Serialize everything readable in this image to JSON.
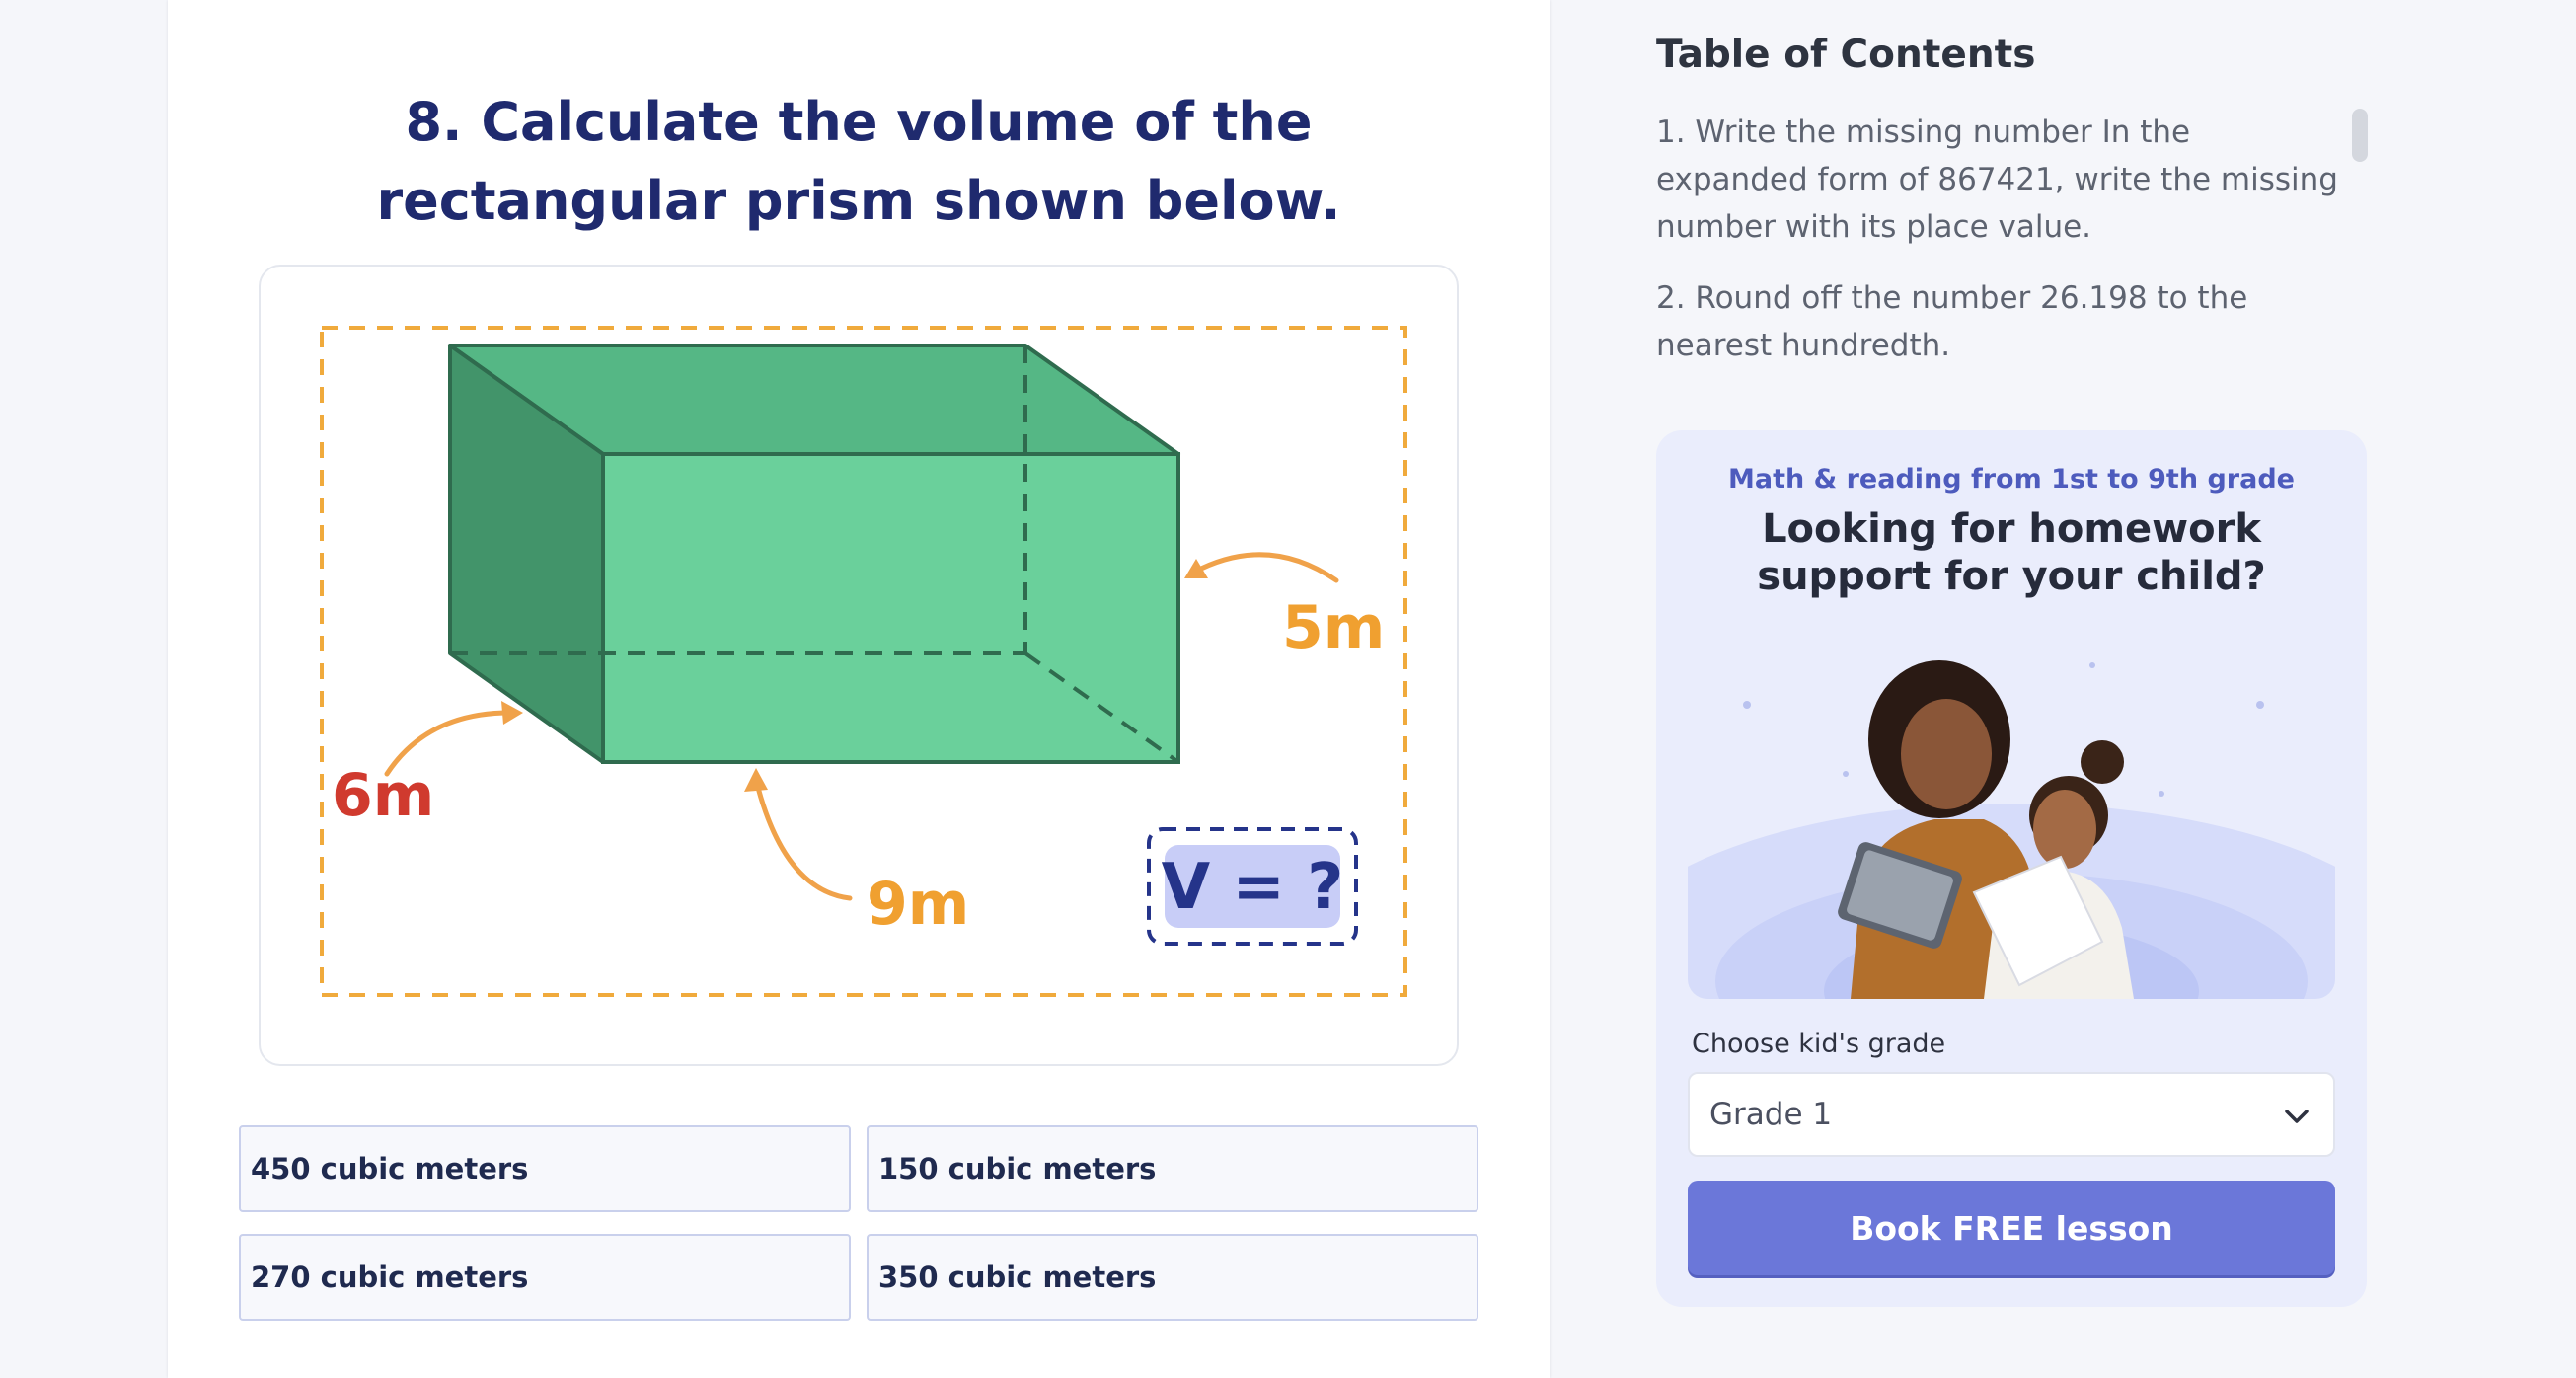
{
  "question": {
    "title": "8. Calculate the volume of the rectangular prism shown below.",
    "figure": {
      "label_depth": "6m",
      "label_length": "9m",
      "label_height": "5m",
      "label_volume": "V = ?",
      "colors": {
        "prism_front": "#6ad09b",
        "prism_top": "#55b785",
        "prism_side": "#42946a",
        "edge": "#2f6b4e",
        "dashed_frame": "#f0aa3c",
        "arrow": "#f0a24a",
        "label_red": "#d03a2e",
        "label_orange": "#f0a030",
        "volume_text": "#25348a",
        "volume_bg": "#c8cdf7"
      }
    },
    "options": [
      {
        "label": "450 cubic meters"
      },
      {
        "label": "150 cubic meters"
      },
      {
        "label": "270 cubic meters"
      },
      {
        "label": "350 cubic meters"
      }
    ]
  },
  "toc": {
    "title": "Table of Contents",
    "items": [
      {
        "label": "1. Write the missing number In the expanded form of 867421, write the missing number with its place value."
      },
      {
        "label": "2. Round off the number 26.198 to the nearest hundredth."
      }
    ]
  },
  "promo": {
    "kicker": "Math & reading from 1st to 9th grade",
    "title": "Looking for homework support for your child?",
    "grade_label": "Choose kid's grade",
    "grade_value": "Grade 1",
    "button_label": "Book FREE lesson",
    "colors": {
      "accent": "#6b77d9",
      "panel_bg": "#eaedfc"
    }
  }
}
